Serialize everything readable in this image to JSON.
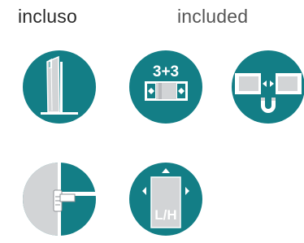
{
  "labels": {
    "italian": "incluso",
    "english": "included"
  },
  "colors": {
    "teal": "#137e86",
    "white": "#ffffff",
    "light_gray": "#d2d4d6",
    "mid_gray": "#8e9094",
    "dark_text": "#2a2a2a"
  },
  "icons": [
    {
      "name": "glass-panel-wall-icon"
    },
    {
      "name": "three-plus-three-icon",
      "text": "3+3"
    },
    {
      "name": "magnetic-closure-icon"
    },
    {
      "name": "handle-door-icon"
    },
    {
      "name": "left-right-height-adjust-icon",
      "text": "L/H"
    }
  ]
}
